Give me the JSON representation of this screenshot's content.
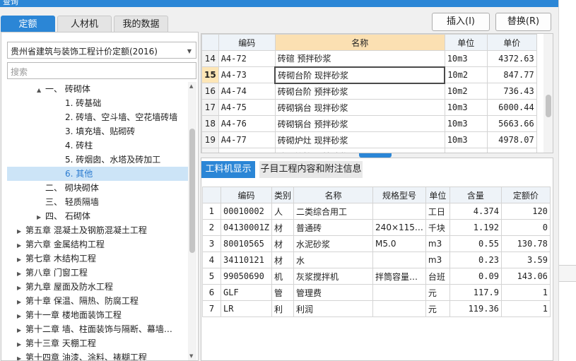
{
  "window": {
    "title": "查询"
  },
  "tabs": [
    {
      "label": "定额",
      "active": true
    },
    {
      "label": "人材机",
      "active": false
    },
    {
      "label": "我的数据",
      "active": false
    }
  ],
  "toolbar": {
    "insert_label": "插入(I)",
    "replace_label": "替换(R)"
  },
  "left": {
    "library_select": "贵州省建筑与装饰工程计价定额(2016)",
    "search_placeholder": "搜索",
    "tree": [
      {
        "indent": 3,
        "expander": "▲",
        "label": "一、 砖砌体"
      },
      {
        "indent": 5,
        "expander": "",
        "label": "1. 砖基础"
      },
      {
        "indent": 5,
        "expander": "",
        "label": "2. 砖墙、空斗墙、空花墙砖墙"
      },
      {
        "indent": 5,
        "expander": "",
        "label": "3. 填充墙、贴砌砖"
      },
      {
        "indent": 5,
        "expander": "",
        "label": "4. 砖柱"
      },
      {
        "indent": 5,
        "expander": "",
        "label": "5. 砖烟囱、水塔及砖加工"
      },
      {
        "indent": 5,
        "expander": "",
        "label": "6. 其他",
        "selected": true
      },
      {
        "indent": 3,
        "expander": "",
        "label": "二、 砌块砌体"
      },
      {
        "indent": 3,
        "expander": "",
        "label": "三、 轻质隔墙"
      },
      {
        "indent": 3,
        "expander": "▶",
        "label": "四、 石砌体"
      },
      {
        "indent": 1,
        "expander": "▶",
        "label": "第五章 混凝土及钢筋混凝土工程"
      },
      {
        "indent": 1,
        "expander": "▶",
        "label": "第六章 金属结构工程"
      },
      {
        "indent": 1,
        "expander": "▶",
        "label": "第七章 木结构工程"
      },
      {
        "indent": 1,
        "expander": "▶",
        "label": "第八章 门窗工程"
      },
      {
        "indent": 1,
        "expander": "▶",
        "label": "第九章 屋面及防水工程"
      },
      {
        "indent": 1,
        "expander": "▶",
        "label": "第十章 保温、隔热、防腐工程"
      },
      {
        "indent": 1,
        "expander": "▶",
        "label": "第十一章 楼地面装饰工程"
      },
      {
        "indent": 1,
        "expander": "▶",
        "label": "第十二章 墙、柱面装饰与隔断、幕墙…"
      },
      {
        "indent": 1,
        "expander": "▶",
        "label": "第十三章 天棚工程"
      },
      {
        "indent": 1,
        "expander": "▶",
        "label": "第十四章 油漆、涂料、裱糊工程"
      }
    ]
  },
  "quota_table": {
    "headers": [
      "编码",
      "名称",
      "单位",
      "单价"
    ],
    "rows": [
      {
        "no": "14",
        "code": "A4-72",
        "name": "砖碹 预拌砂浆",
        "unit": "10m3",
        "price": "4372.63"
      },
      {
        "no": "15",
        "code": "A4-73",
        "name": "砖砌台阶 现拌砂浆",
        "unit": "10m2",
        "price": "847.77",
        "current": true
      },
      {
        "no": "16",
        "code": "A4-74",
        "name": "砖砌台阶 预拌砂浆",
        "unit": "10m2",
        "price": "736.43"
      },
      {
        "no": "17",
        "code": "A4-75",
        "name": "砖砌锅台 现拌砂浆",
        "unit": "10m3",
        "price": "6000.44"
      },
      {
        "no": "18",
        "code": "A4-76",
        "name": "砖砌锅台 预拌砂浆",
        "unit": "10m3",
        "price": "5663.66"
      },
      {
        "no": "19",
        "code": "A4-77",
        "name": "砖砌炉灶 现拌砂浆",
        "unit": "10m3",
        "price": "4978.07"
      },
      {
        "no": "20",
        "code": "A4-78",
        "name": "砖砌炉灶 预拌砂浆",
        "unit": "10m3",
        "price": "4649.03"
      }
    ]
  },
  "detail": {
    "tabs": [
      {
        "label": "工料机显示",
        "active": true
      },
      {
        "label": "子目工程内容和附注信息",
        "active": false
      }
    ],
    "headers": [
      "编码",
      "类别",
      "名称",
      "规格型号",
      "单位",
      "含量",
      "定额价"
    ],
    "rows": [
      {
        "no": "1",
        "code": "00010002",
        "cat": "人",
        "name": "二类综合用工",
        "spec": "",
        "unit": "工日",
        "qty": "4.374",
        "price": "120"
      },
      {
        "no": "2",
        "code": "04130001Z",
        "cat": "材",
        "name": "普通砖",
        "spec": "240×115…",
        "unit": "千块",
        "qty": "1.192",
        "price": "0"
      },
      {
        "no": "3",
        "code": "80010565",
        "cat": "材",
        "name": "水泥砂浆",
        "spec": "M5.0",
        "unit": "m3",
        "qty": "0.55",
        "price": "130.78"
      },
      {
        "no": "4",
        "code": "34110121",
        "cat": "材",
        "name": "水",
        "spec": "",
        "unit": "m3",
        "qty": "0.23",
        "price": "3.59"
      },
      {
        "no": "5",
        "code": "99050690",
        "cat": "机",
        "name": "灰浆搅拌机",
        "spec": "拌筒容量…",
        "unit": "台班",
        "qty": "0.09",
        "price": "143.06"
      },
      {
        "no": "6",
        "code": "GLF",
        "cat": "管",
        "name": "管理费",
        "spec": "",
        "unit": "元",
        "qty": "117.9",
        "price": "1"
      },
      {
        "no": "7",
        "code": "LR",
        "cat": "利",
        "name": "利润",
        "spec": "",
        "unit": "元",
        "qty": "119.36",
        "price": "1"
      }
    ]
  },
  "colors": {
    "accent": "#2b86d6",
    "selected_bg": "#cce4f7",
    "name_header": "#fbe0b2"
  }
}
